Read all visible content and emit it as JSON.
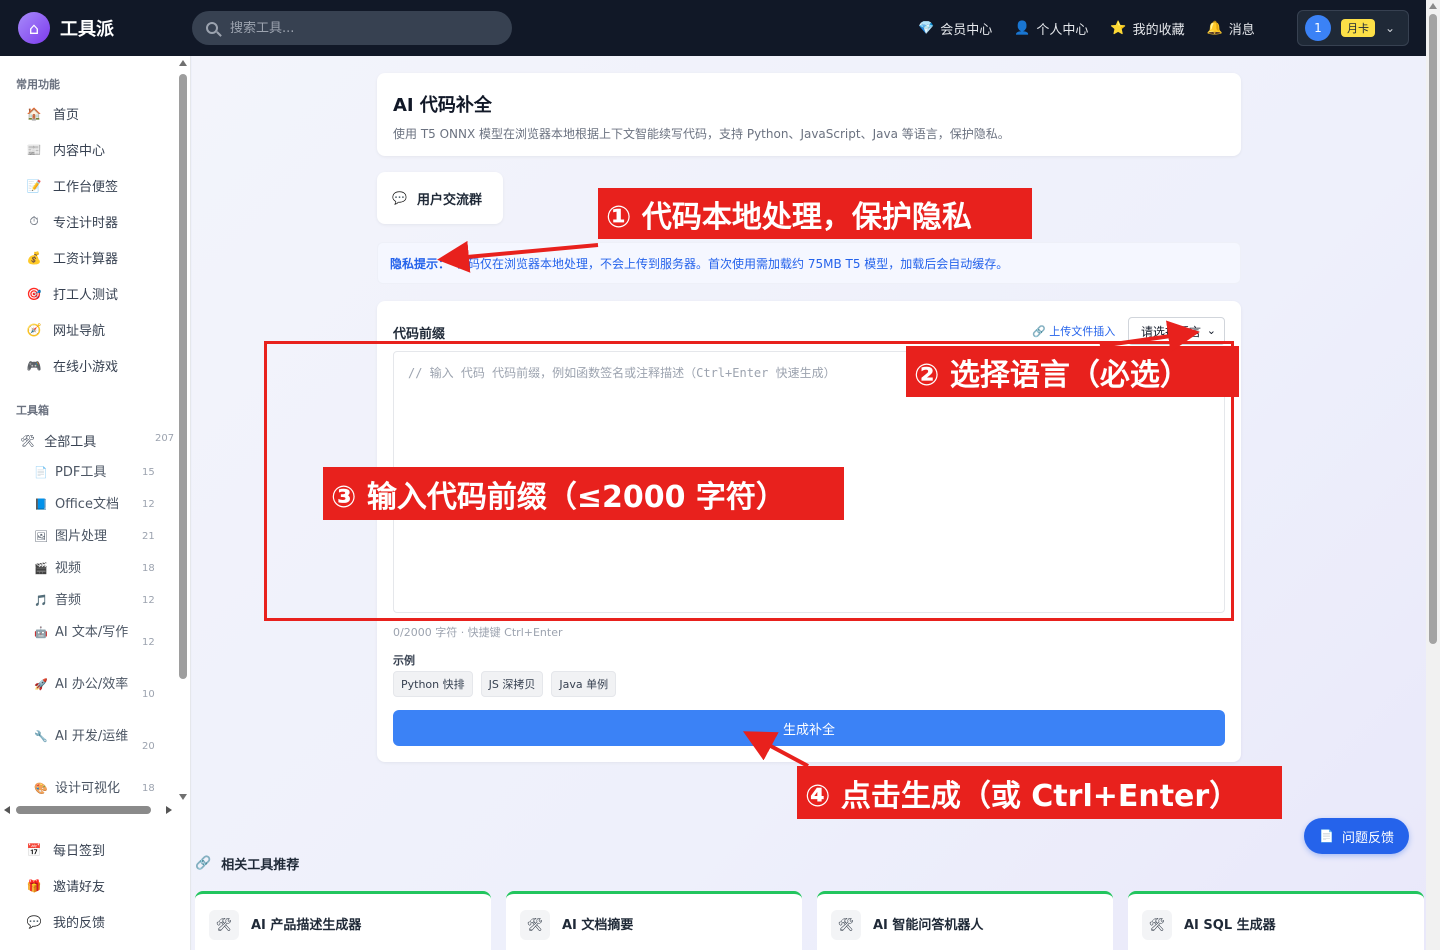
{
  "header": {
    "logo_text": "工具派",
    "search_placeholder": "搜索工具...",
    "nav": [
      {
        "icon": "💎",
        "label": "会员中心"
      },
      {
        "icon": "👤",
        "label": "个人中心"
      },
      {
        "icon": "⭐",
        "label": "我的收藏"
      },
      {
        "icon": "🔔",
        "label": "消息"
      }
    ],
    "user": {
      "avatar": "1",
      "plan": "月卡"
    }
  },
  "sidebar": {
    "common_title": "常用功能",
    "common": [
      {
        "icon": "🏠",
        "label": "首页"
      },
      {
        "icon": "📰",
        "label": "内容中心"
      },
      {
        "icon": "📝",
        "label": "工作台便签"
      },
      {
        "icon": "⏱",
        "label": "专注计时器"
      },
      {
        "icon": "💰",
        "label": "工资计算器"
      },
      {
        "icon": "🎯",
        "label": "打工人测试"
      },
      {
        "icon": "🧭",
        "label": "网址导航"
      },
      {
        "icon": "🎮",
        "label": "在线小游戏"
      }
    ],
    "toolbox_title": "工具箱",
    "all_tools": {
      "icon": "🛠",
      "label": "全部工具",
      "count": "207"
    },
    "tools": [
      {
        "icon": "📄",
        "label": "PDF工具",
        "count": "15"
      },
      {
        "icon": "📘",
        "label": "Office文档",
        "count": "12"
      },
      {
        "icon": "🖼",
        "label": "图片处理",
        "count": "21"
      },
      {
        "icon": "🎬",
        "label": "视频",
        "count": "18"
      },
      {
        "icon": "🎵",
        "label": "音频",
        "count": "12"
      },
      {
        "icon": "🤖",
        "label": "AI 文本/写作",
        "count": "12"
      },
      {
        "icon": "🚀",
        "label": "AI 办公/效率",
        "count": "10"
      },
      {
        "icon": "🔧",
        "label": "AI 开发/运维",
        "count": "20"
      },
      {
        "icon": "🎨",
        "label": "设计可视化",
        "count": "18"
      }
    ],
    "bottom": [
      {
        "icon": "📅",
        "label": "每日签到"
      },
      {
        "icon": "🎁",
        "label": "邀请好友"
      },
      {
        "icon": "💬",
        "label": "我的反馈"
      }
    ]
  },
  "main": {
    "title": "AI 代码补全",
    "description": "使用 T5 ONNX 模型在浏览器本地根据上下文智能续写代码，支持 Python、JavaScript、Java 等语言，保护隐私。",
    "group_button": "用户交流群",
    "privacy_label": "隐私提示：",
    "privacy_text": "代码仅在浏览器本地处理，不会上传到服务器。首次使用需加载约 75MB T5 模型，加载后会自动缓存。",
    "prefix_label": "代码前缀",
    "upload_label": "上传文件插入",
    "language_select": "请选择语言",
    "code_placeholder": "// 输入 代码 代码前缀，例如函数签名或注释描述（Ctrl+Enter 快速生成）",
    "char_count": "0/2000 字符 · 快捷键 Ctrl+Enter",
    "examples_label": "示例",
    "examples": [
      "Python 快排",
      "JS 深拷贝",
      "Java 单例"
    ],
    "generate_button": "生成补全",
    "related_title": "相关工具推荐",
    "related": [
      {
        "icon": "🛠",
        "name": "AI 产品描述生成器"
      },
      {
        "icon": "🛠",
        "name": "AI 文档摘要"
      },
      {
        "icon": "🛠",
        "name": "AI 智能问答机器人"
      },
      {
        "icon": "🛠",
        "name": "AI SQL 生成器"
      }
    ],
    "feedback_button": "问题反馈"
  },
  "annotations": [
    "① 代码本地处理，保护隐私",
    "② 选择语言（必选）",
    "③ 输入代码前缀（≤2000 字符）",
    "④ 点击生成（或 Ctrl+Enter）"
  ],
  "colors": {
    "accent": "#3b82f6",
    "annotation": "#e8211d",
    "topbar": "#111827"
  }
}
